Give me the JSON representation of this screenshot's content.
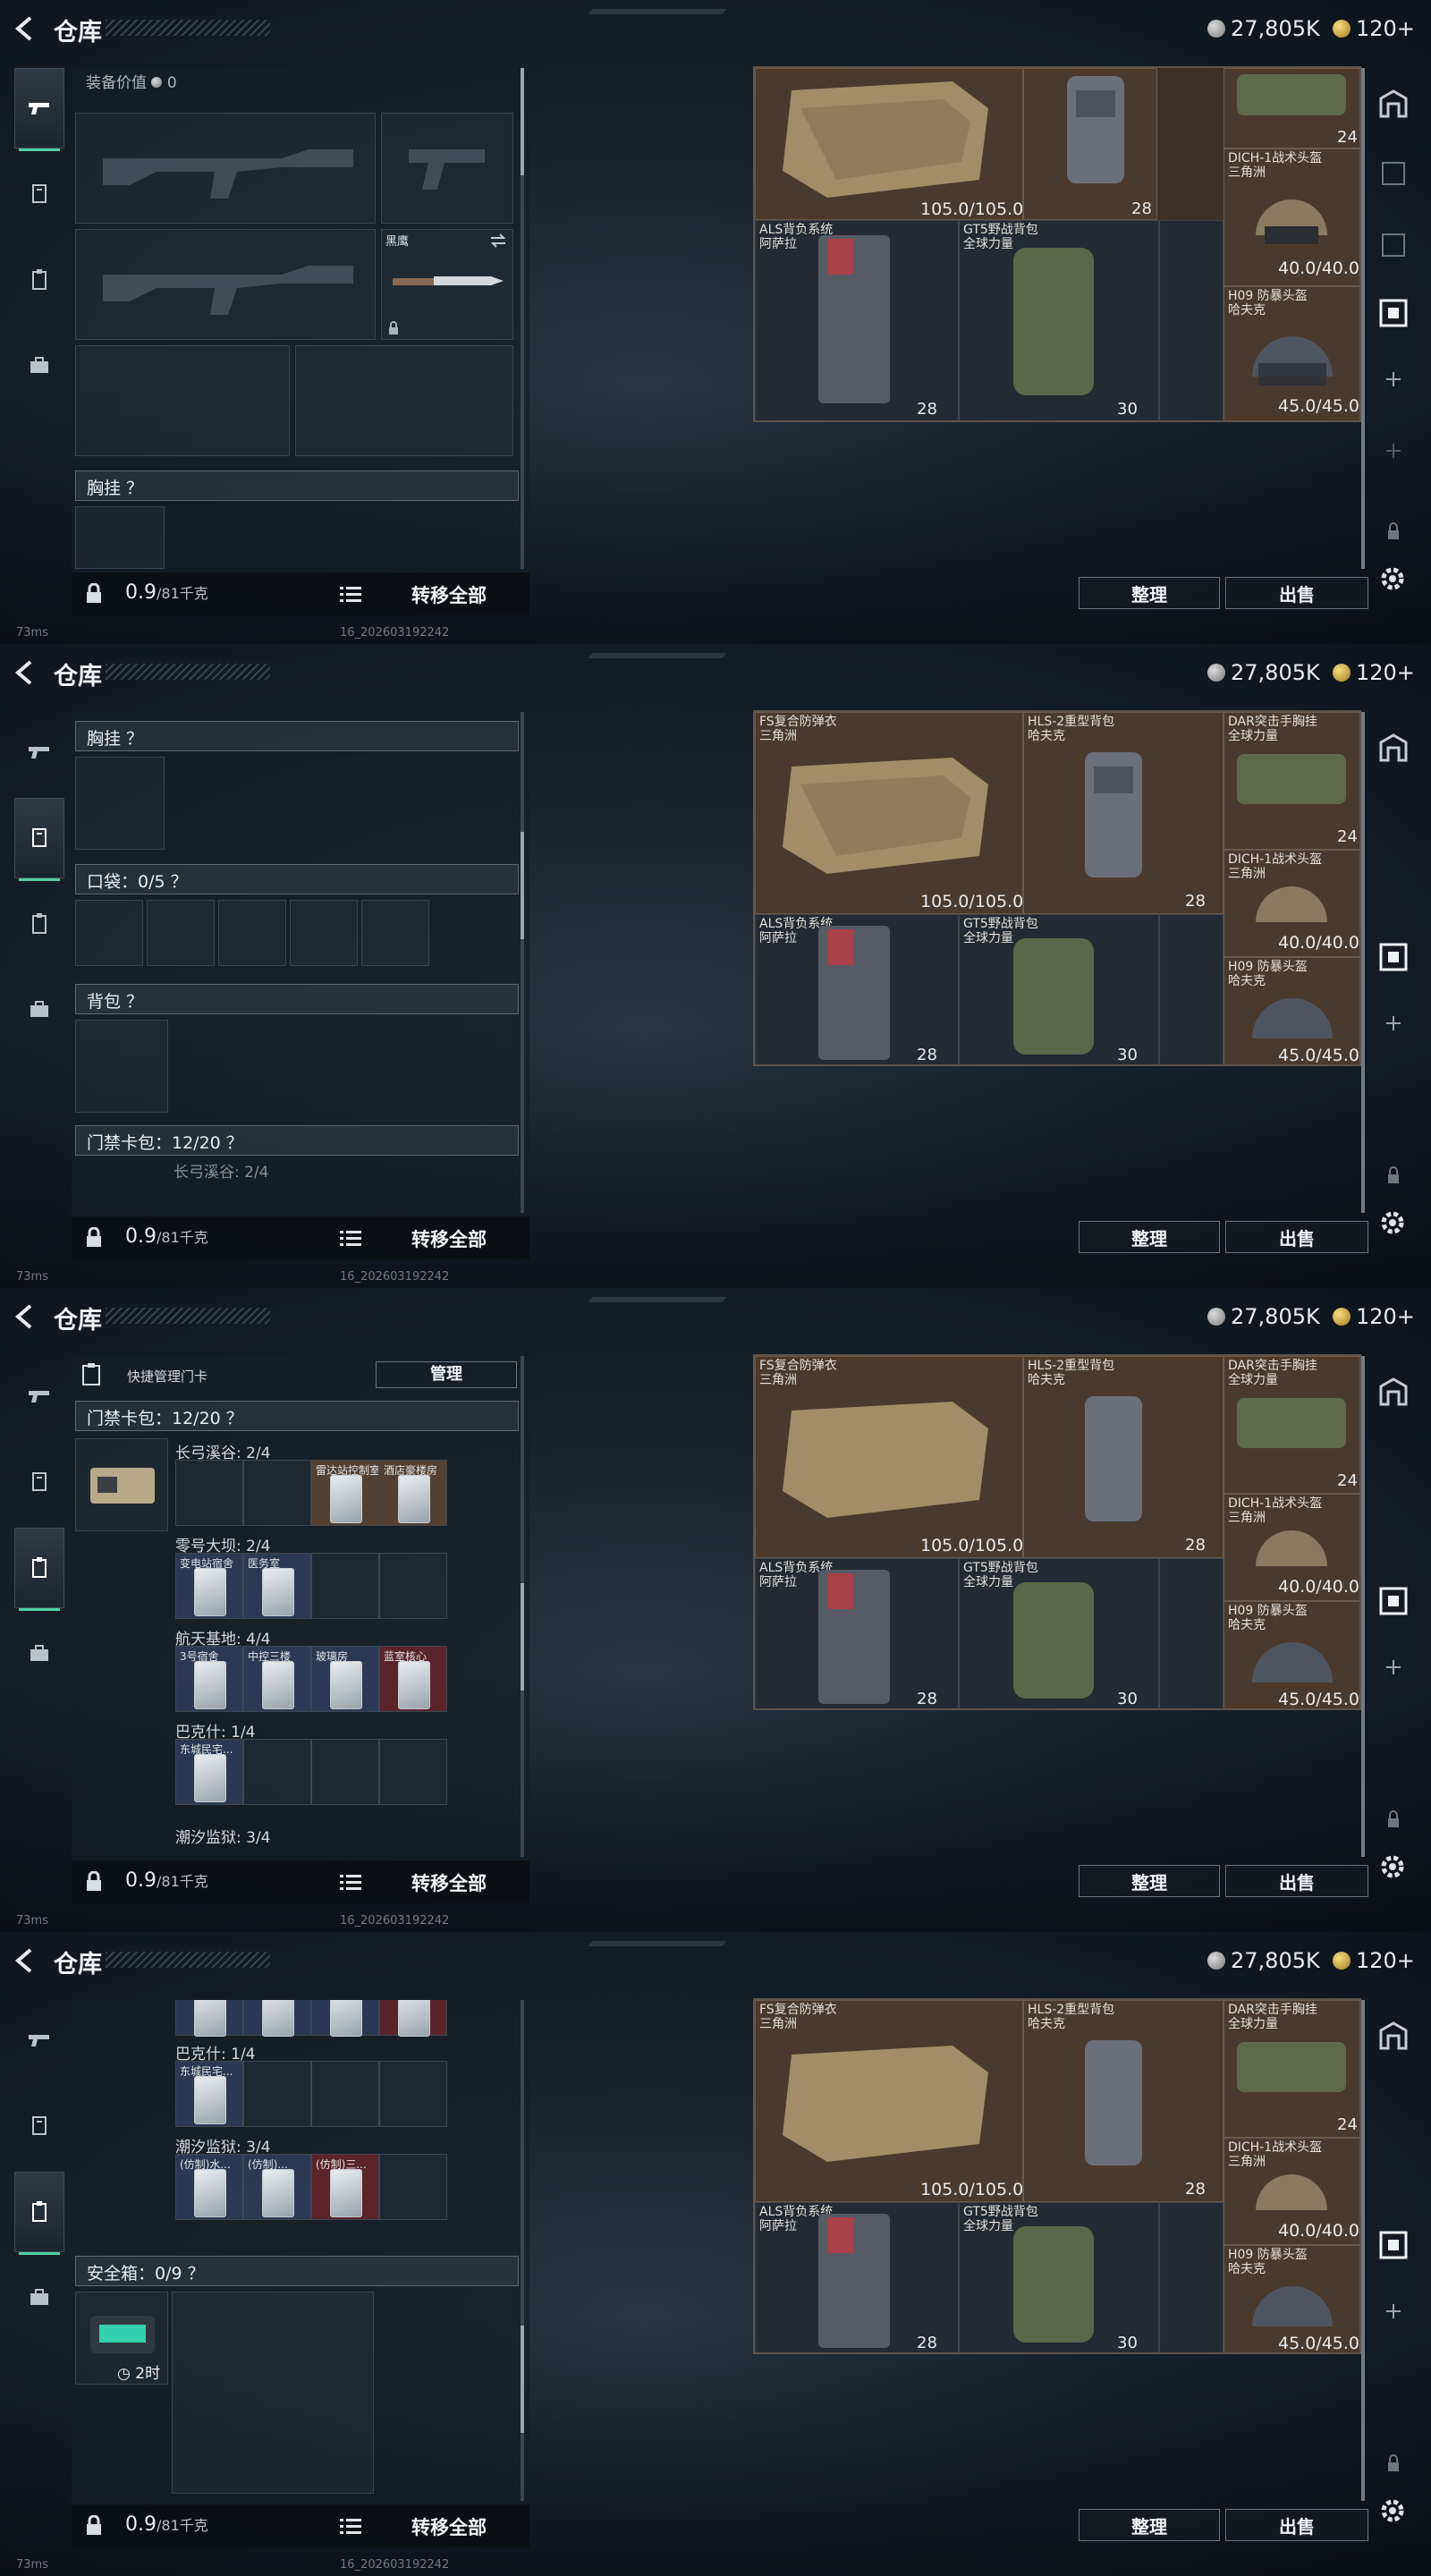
{
  "screen": {
    "title": "仓库",
    "currency": {
      "silver": "27,805K",
      "gold": "120+"
    },
    "status": {
      "ping": "73ms",
      "build": "16_202603192242"
    }
  },
  "inventory_panel": {
    "equip_value_label": "装备价值",
    "equip_value": "0",
    "secondary_weapon_label": "黑鹰",
    "chest_rig_label": "胸挂 ？",
    "pockets_label": "口袋：0/5 ？",
    "backpack_label": "背包 ？",
    "keycard_pack_label": "门禁卡包：12/20 ？",
    "quick_manage_label": "快捷管理门卡",
    "manage_button": "管理",
    "safe_box_label": "安全箱：0/9 ？",
    "safe_timer": "2时",
    "weight": "0.9",
    "weight_max": "/81千克",
    "transfer_all": "转移全部"
  },
  "keycard_zones": [
    {
      "name": "长弓溪谷: 2/4",
      "cards": [
        "",
        "",
        "雷达站控制室",
        "酒店豪楼房"
      ],
      "colors": [
        "dark",
        "dark",
        "amber",
        "amber"
      ]
    },
    {
      "name": "零号大坝: 2/4",
      "cards": [
        "变电站宿舍",
        "医务室",
        "",
        ""
      ],
      "colors": [
        "blue",
        "blue",
        "dark",
        "dark"
      ]
    },
    {
      "name": "航天基地: 4/4",
      "cards": [
        "3号宿舍",
        "中控三楼",
        "玻璃房",
        "蓝室核心"
      ],
      "colors": [
        "blue",
        "blue",
        "blue",
        "red"
      ]
    },
    {
      "name": "巴克什: 1/4",
      "cards": [
        "东城民宅...",
        "",
        "",
        ""
      ],
      "colors": [
        "blue",
        "dark",
        "dark",
        "dark"
      ]
    },
    {
      "name": "潮汐监狱: 3/4",
      "cards": [
        "(仿制)水...",
        "(仿制)...",
        "(仿制)三...",
        ""
      ],
      "colors": [
        "blue",
        "blue",
        "red",
        "dark"
      ]
    }
  ],
  "stash_items": [
    {
      "name": "FS复合防弹衣",
      "sub": "三角洲",
      "durability": "105.0/105.0"
    },
    {
      "name": "HLS-2重型背包",
      "sub": "哈夫克",
      "badge": "28"
    },
    {
      "name": "DAR突击手胸挂",
      "sub": "全球力量",
      "badge": "24"
    },
    {
      "name": "DICH-1战术头盔",
      "sub": "三角洲",
      "durability": "40.0/40.0"
    },
    {
      "name": "ALS背负系统",
      "sub": "阿萨拉",
      "badge": "28"
    },
    {
      "name": "GT5野战背包",
      "sub": "全球力量",
      "badge": "30"
    },
    {
      "name": "H09 防暴头盔",
      "sub": "哈夫克",
      "durability": "45.0/45.0"
    }
  ],
  "actions": {
    "sort": "整理",
    "sell": "出售"
  }
}
